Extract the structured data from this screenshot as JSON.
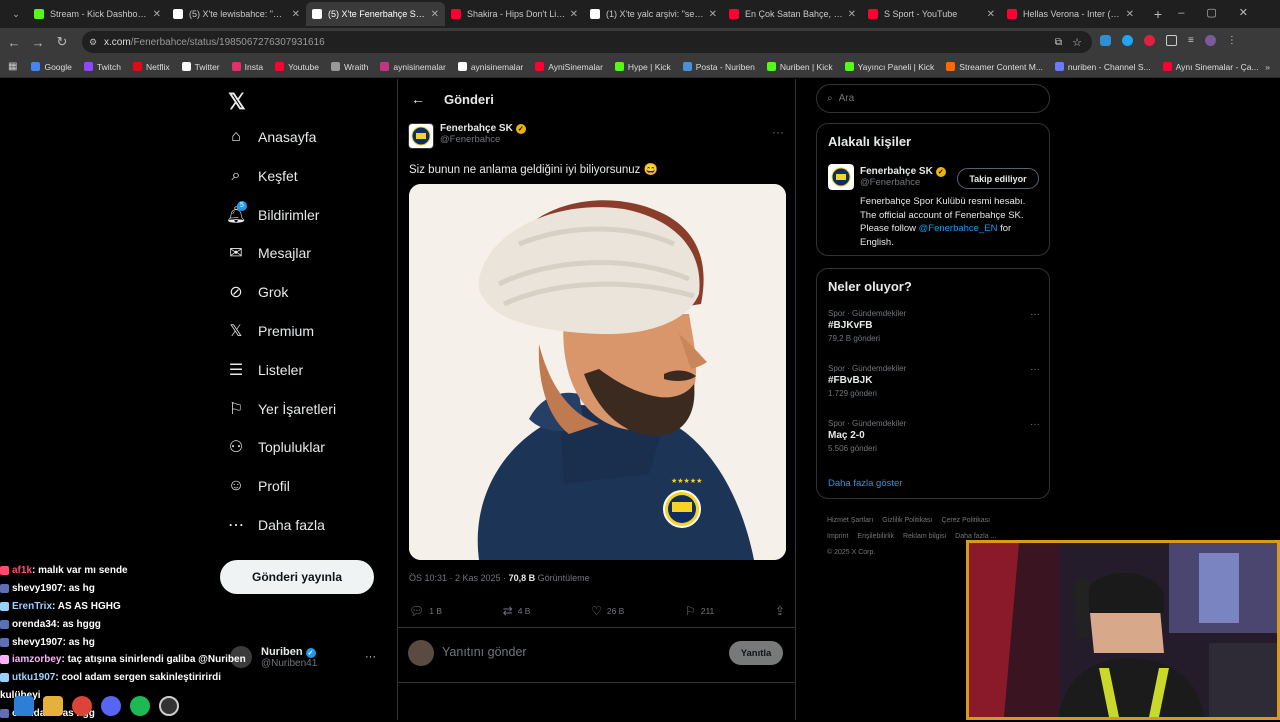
{
  "browser": {
    "tabs": [
      {
        "title": "Stream - Kick Dashboard",
        "color": "#53fc18"
      },
      {
        "title": "(5) X'te lewisbahce: \"ALEM",
        "color": "#ffffff"
      },
      {
        "title": "(5) X'te Fenerbahçe SK: \"S",
        "color": "#ffffff",
        "active": true
      },
      {
        "title": "Shakira - Hips Don't Lie w",
        "color": "#ff0033"
      },
      {
        "title": "(1) X'te yalc arşivi: \"sergen",
        "color": "#ffffff"
      },
      {
        "title": "En Çok Satan Bahçe, Balk",
        "color": "#ff0033"
      },
      {
        "title": "S Sport - YouTube",
        "color": "#ff0033"
      },
      {
        "title": "Hellas Verona - Inter (1-2",
        "color": "#ff0033"
      }
    ],
    "url_host": "x.com",
    "url_path": "/Fenerbahce/status/1985067276307931616",
    "bookmarks": [
      {
        "label": "Google",
        "color": "#4285f4"
      },
      {
        "label": "Twitch",
        "color": "#9146ff"
      },
      {
        "label": "Netflix",
        "color": "#e50914"
      },
      {
        "label": "Twitter",
        "color": "#ffffff"
      },
      {
        "label": "Insta",
        "color": "#e1306c"
      },
      {
        "label": "Youtube",
        "color": "#ff0033"
      },
      {
        "label": "Wraith",
        "color": "#999999"
      },
      {
        "label": "aynisinemalar",
        "color": "#c13584"
      },
      {
        "label": "aynisinemalar",
        "color": "#ffffff"
      },
      {
        "label": "AyniSinemalar",
        "color": "#ff0033"
      },
      {
        "label": "Hype | Kick",
        "color": "#53fc18"
      },
      {
        "label": "Posta - Nuriben",
        "color": "#4a90d9"
      },
      {
        "label": "Nuriben | Kick",
        "color": "#53fc18"
      },
      {
        "label": "Yayıncı Paneli | Kick",
        "color": "#53fc18"
      },
      {
        "label": "Streamer Content M...",
        "color": "#ff6a00"
      },
      {
        "label": "nuriben - Channel S...",
        "color": "#6a7bff"
      },
      {
        "label": "Aynı Sinemalar - Ça...",
        "color": "#ff0033"
      }
    ]
  },
  "nav": {
    "items": [
      "Anasayfa",
      "Keşfet",
      "Bildirimler",
      "Mesajlar",
      "Grok",
      "Premium",
      "Listeler",
      "Yer İşaretleri",
      "Topluluklar",
      "Profil",
      "Daha fazla"
    ],
    "notif_count": "5",
    "post_button": "Gönderi yayınla",
    "account_name": "Nuriben",
    "account_handle": "@Nuriben41"
  },
  "post": {
    "header": "Gönderi",
    "author": "Fenerbahçe SK",
    "handle": "@Fenerbahce",
    "text": "Siz bunun ne anlama geldiğini iyi biliyorsunuz 😄",
    "time": "ÖS 10:31 · 2 Kas 2025 · ",
    "views": "70,8 B",
    "views_label": " Görüntüleme",
    "replies": "1 B",
    "reposts": "4 B",
    "likes": "26 B",
    "bookmarks": "211",
    "reply_placeholder": "Yanıtını gönder",
    "reply_button": "Yanıtla"
  },
  "sidebar": {
    "search_placeholder": "Ara",
    "related_title": "Alakalı kişiler",
    "related_name": "Fenerbahçe SK",
    "related_handle": "@Fenerbahce",
    "follow_label": "Takip ediliyor",
    "bio": "Fenerbahçe Spor Kulübü resmi hesabı. The official account of Fenerbahçe SK. Please follow ",
    "bio_link": "@Fenerbahce_EN",
    "bio_end": " for English.",
    "trends_title": "Neler oluyor?",
    "trends": [
      {
        "category": "Spor · Gündemdekiler",
        "title": "#BJKvFB",
        "count": "79,2 B gönderi"
      },
      {
        "category": "Spor · Gündemdekiler",
        "title": "#FBvBJK",
        "count": "1.729 gönderi"
      },
      {
        "category": "Spor · Gündemdekiler",
        "title": "Maç 2-0",
        "count": "5.506 gönderi"
      }
    ],
    "show_more": "Daha fazla göster",
    "footer": [
      "Hizmet Şartları",
      "Gizlilik Politikası",
      "Çerez Politikası",
      "Imprint",
      "Erişilebilirlik",
      "Reklam bilgisi",
      "Daha fazla ...",
      "© 2025 X Corp."
    ]
  },
  "chat": [
    {
      "user": "af1k",
      "msg": " : malık var mı sende",
      "color": "#ff4d6d"
    },
    {
      "user": "shevy1907",
      "msg": " : as hg",
      "color": "#ffffff"
    },
    {
      "user": "ErenTrix",
      "msg": " : AS AS HGHG",
      "color": "#9ad0ff"
    },
    {
      "user": "orenda34",
      "msg": " : as hggg",
      "color": "#ffffff"
    },
    {
      "user": "shevy1907",
      "msg": " : as hg",
      "color": "#ffffff"
    },
    {
      "user": "iamzorbey",
      "msg": " : taç atışına sinirlendi galiba @Nuriben",
      "color": "#ffb0ff"
    },
    {
      "user": "utku1907",
      "msg": " : cool adam sergen sakinleştiririrdi",
      "color": "#9ad0ff"
    },
    {
      "user": "kulübeyi",
      "msg": "",
      "color": "#ffffff"
    },
    {
      "user": "orenda34",
      "msg": " : as hgg",
      "color": "#ffffff"
    }
  ]
}
